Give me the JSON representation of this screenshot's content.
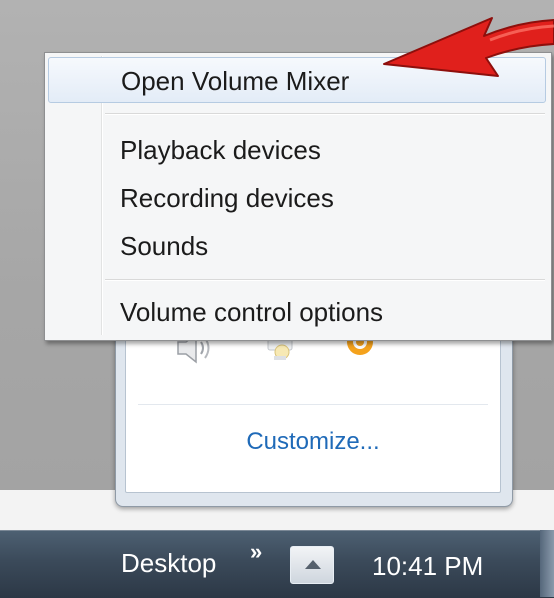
{
  "context_menu": {
    "items": [
      {
        "label": "Open Volume Mixer"
      },
      {
        "label": "Playback devices"
      },
      {
        "label": "Recording devices"
      },
      {
        "label": "Sounds"
      },
      {
        "label": "Volume control options"
      }
    ]
  },
  "tray_popup": {
    "icons": [
      "speaker-icon",
      "network-icon",
      "orange-app-icon"
    ],
    "customize_label": "Customize..."
  },
  "taskbar": {
    "desktop_label": "Desktop",
    "chevron": "»",
    "clock": "10:41 PM"
  },
  "colors": {
    "arrow": "#e0201c",
    "link": "#1f6ab8",
    "taskbar": "#3b4a5a"
  }
}
